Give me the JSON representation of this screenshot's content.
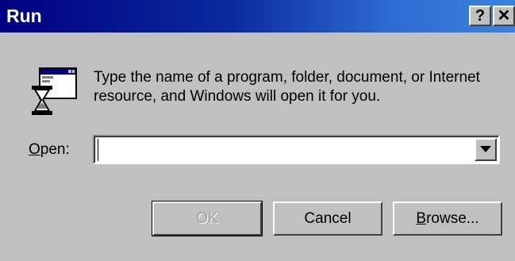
{
  "window": {
    "title": "Run",
    "help_label": "?",
    "close_label": "✕"
  },
  "dialog": {
    "icon": "run-program-icon",
    "description_line1": "Type the name of a program, folder, document, or Internet",
    "description_line2": "resource, and Windows will open it for you.",
    "open_label_first": "O",
    "open_label_rest": "pen:",
    "open_value": "",
    "open_placeholder": ""
  },
  "buttons": {
    "ok_label": "OK",
    "cancel_label": "Cancel",
    "browse_label_first": "B",
    "browse_label_rest": "rowse..."
  },
  "colors": {
    "titlebar_start": "#000080",
    "titlebar_end": "#3a82e0",
    "face": "#c0c0c0"
  }
}
